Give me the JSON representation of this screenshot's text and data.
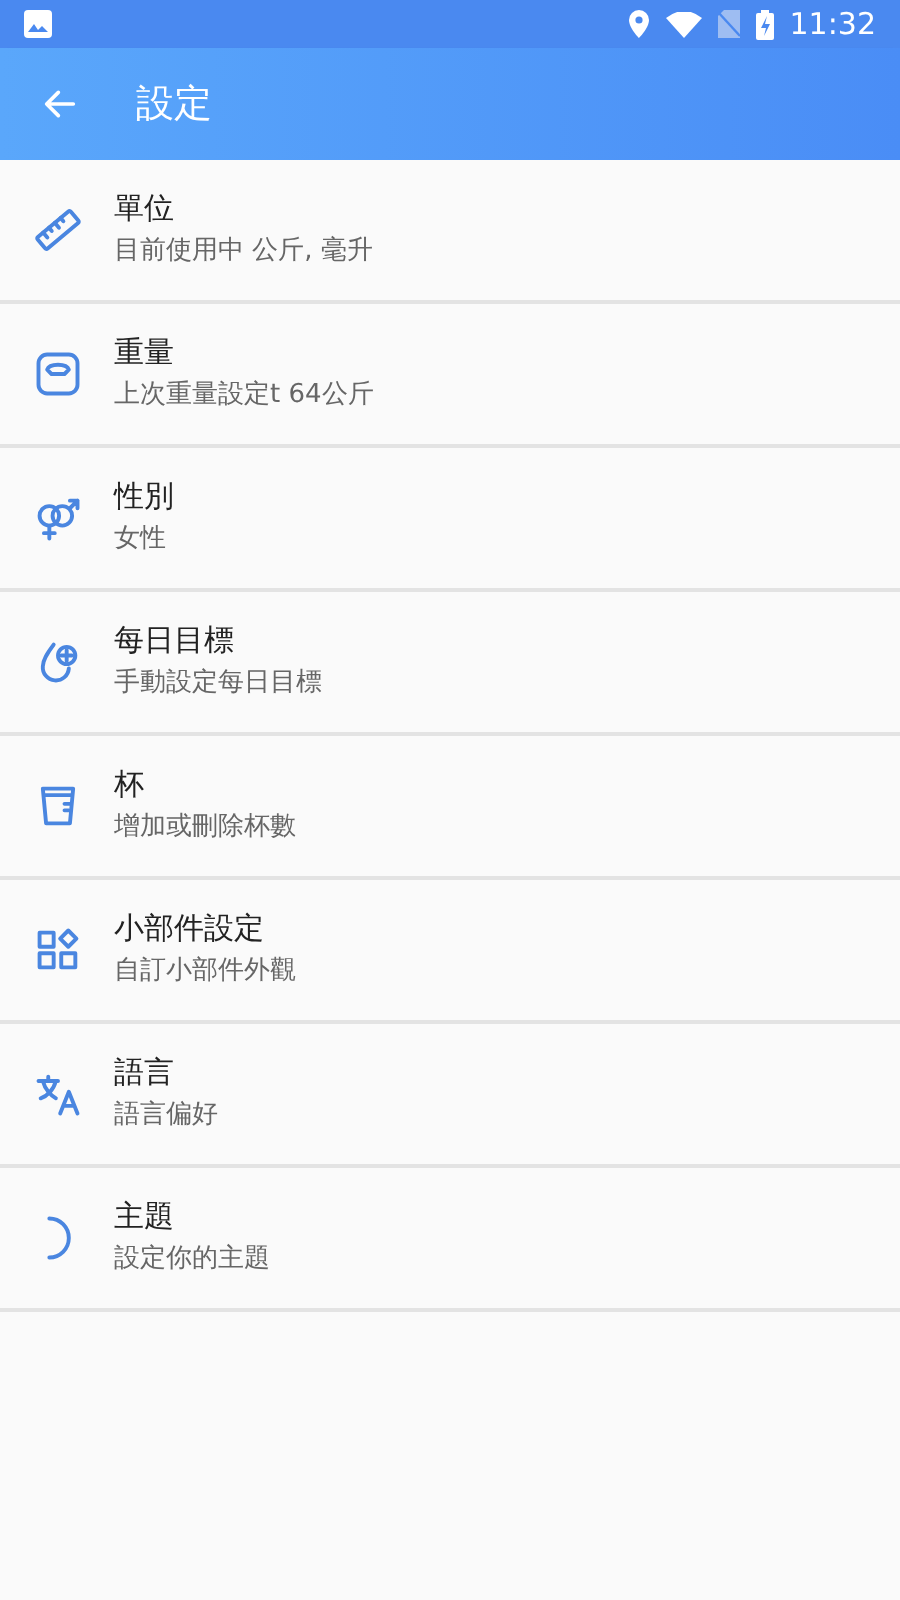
{
  "status_bar": {
    "time": "11:32"
  },
  "app_bar": {
    "title": "設定"
  },
  "items": [
    {
      "kind": "units",
      "title": "單位",
      "subtitle": "目前使用中 公斤, 毫升"
    },
    {
      "kind": "weight",
      "title": "重量",
      "subtitle": "上次重量設定t 64公斤"
    },
    {
      "kind": "gender",
      "title": "性別",
      "subtitle": "女性"
    },
    {
      "kind": "goal",
      "title": "每日目標",
      "subtitle": "手動設定每日目標"
    },
    {
      "kind": "cup",
      "title": "杯",
      "subtitle": "增加或刪除杯數"
    },
    {
      "kind": "widget",
      "title": "小部件設定",
      "subtitle": "自訂小部件外觀"
    },
    {
      "kind": "language",
      "title": "語言",
      "subtitle": "語言偏好"
    },
    {
      "kind": "theme",
      "title": "主題",
      "subtitle": "設定你的主題"
    }
  ]
}
